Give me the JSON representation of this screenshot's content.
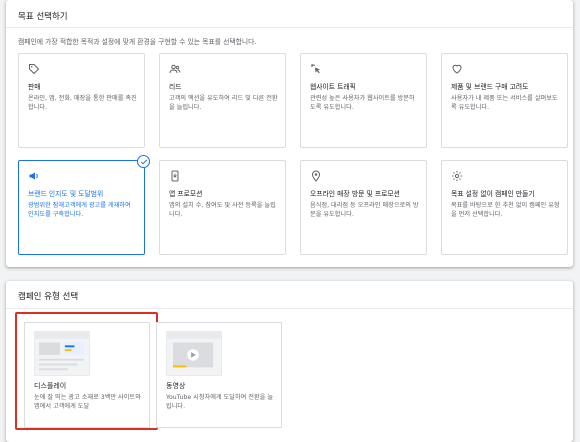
{
  "objective_section": {
    "title": "목표 선택하기",
    "subtitle": "캠페인에 가장 적합한 목적과 설정에 맞게 환경을 구현할 수 있는 목표를 선택합니다.",
    "cards": [
      {
        "name": "판매",
        "desc": "온라인, 앱, 전화, 매장을 통한 판매를 촉진합니다.",
        "icon": "tag-icon",
        "selected": false
      },
      {
        "name": "리드",
        "desc": "고객의 액션을 유도하여 리드 및 다른 전환을 늘립니다.",
        "icon": "people-icon",
        "selected": false
      },
      {
        "name": "웹사이트 트래픽",
        "desc": "관련성 높은 사용자가 웹사이트를 방문하도록 유도합니다.",
        "icon": "cursor-click-icon",
        "selected": false
      },
      {
        "name": "제품 및 브랜드 구매 고려도",
        "desc": "사용자가 내 제품 또는 서비스를 살펴보도록 유도합니다.",
        "icon": "heart-icon",
        "selected": false
      },
      {
        "name": "브랜드 인지도 및 도달범위",
        "desc": "광범위한 잠재고객에게 광고를 게재하여 인지도를 구축합니다.",
        "icon": "megaphone-icon",
        "selected": true
      },
      {
        "name": "앱 프로모션",
        "desc": "앱의 설치 수, 참여도 및 사전 등록을 늘립니다.",
        "icon": "phone-icon",
        "selected": false
      },
      {
        "name": "오프라인 매장 방문 및 프로모션",
        "desc": "음식점, 대리점 등 오프라인 매장으로의 방문을 유도합니다.",
        "icon": "location-pin-icon",
        "selected": false
      },
      {
        "name": "목표 설정 없이 캠페인 만들기",
        "desc": "목표를 바탕으로 한 추천 없이 캠페인 유형을 먼저 선택합니다.",
        "icon": "gear-icon",
        "selected": false
      }
    ]
  },
  "campaign_type_section": {
    "title": "캠페인 유형 선택",
    "types": [
      {
        "name": "디스플레이",
        "desc": "눈에 잘 띄는 광고 소재로 3백만 사이트와 앱에서 고객에게 도달",
        "icon": "display-thumbnail-icon",
        "highlighted": true
      },
      {
        "name": "동영상",
        "desc": "YouTube 시청자에게 도달하여 전환을 늘립니다.",
        "icon": "video-thumbnail-icon",
        "highlighted": false
      }
    ]
  },
  "colors": {
    "accent": "#1a73e8",
    "highlight": "#d93025",
    "video_play": "#fbbc04"
  }
}
